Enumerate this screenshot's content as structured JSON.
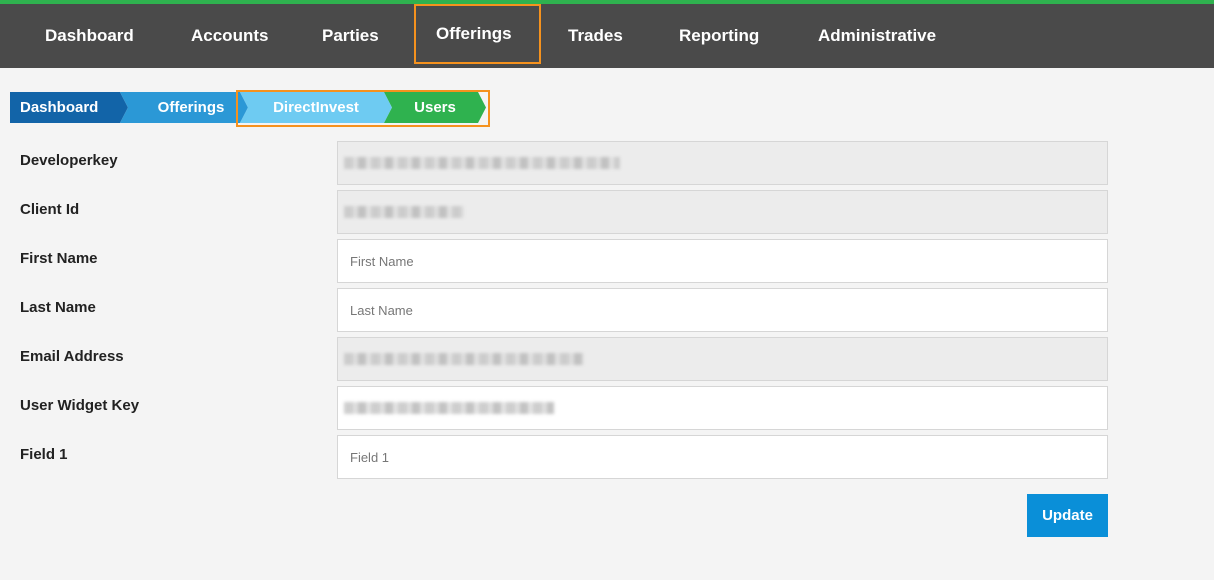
{
  "nav": {
    "items": [
      {
        "label": "Dashboard"
      },
      {
        "label": "Accounts"
      },
      {
        "label": "Parties"
      },
      {
        "label": "Offerings"
      },
      {
        "label": "Trades"
      },
      {
        "label": "Reporting"
      },
      {
        "label": "Administrative"
      }
    ],
    "active": "Offerings"
  },
  "breadcrumb": {
    "items": [
      {
        "label": "Dashboard",
        "color": "#1264a8"
      },
      {
        "label": "Offerings",
        "color": "#2b98d6"
      },
      {
        "label": "DirectInvest",
        "color": "#6ecbf2"
      },
      {
        "label": "Users",
        "color": "#2fb24f"
      }
    ]
  },
  "form": {
    "developer_key": {
      "label": "Developerkey",
      "value": ""
    },
    "client_id": {
      "label": "Client Id",
      "value": ""
    },
    "first_name": {
      "label": "First Name",
      "placeholder": "First Name"
    },
    "last_name": {
      "label": "Last Name",
      "placeholder": "Last Name"
    },
    "email": {
      "label": "Email Address",
      "value": ""
    },
    "user_widget_key": {
      "label": "User Widget Key",
      "value": ""
    },
    "field1": {
      "label": "Field 1",
      "placeholder": "Field 1"
    },
    "update_label": "Update"
  },
  "colors": {
    "topbar": "#4a4a4a",
    "accent_green": "#2fb24f",
    "highlight_orange": "#f5921e",
    "button_blue": "#0a8fd8"
  }
}
